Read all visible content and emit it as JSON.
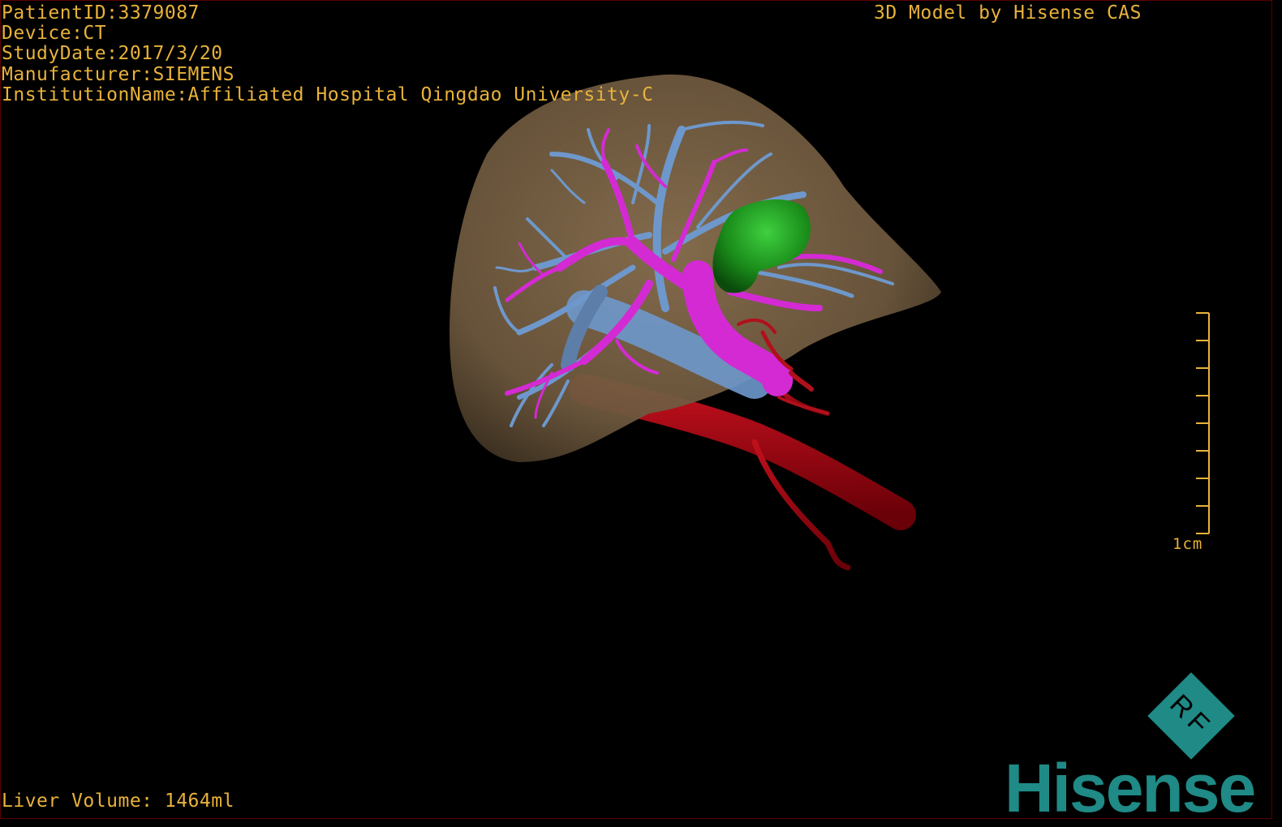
{
  "patient_info": {
    "patient_id": "PatientID:3379087",
    "device": "Device:CT",
    "study_date": "StudyDate:2017/3/20",
    "manufacturer": "Manufacturer:SIEMENS",
    "institution": "InstitutionName:Affiliated Hospital Qingdao University-C"
  },
  "model_credit": "3D Model by Hisense CAS",
  "liver_volume": "Liver Volume: 1464ml",
  "scale_bar": {
    "label": "1cm",
    "ticks": 9
  },
  "logo": {
    "badge_text": "RF",
    "brand": "Hisense",
    "color": "#1f8a86"
  },
  "colors": {
    "text": "#e8b23a",
    "liver": "#7a6246",
    "portal_vein": "#d42ad4",
    "hepatic_vein": "#6e98cc",
    "artery": "#a00d18",
    "tumor": "#1c8a1c"
  }
}
